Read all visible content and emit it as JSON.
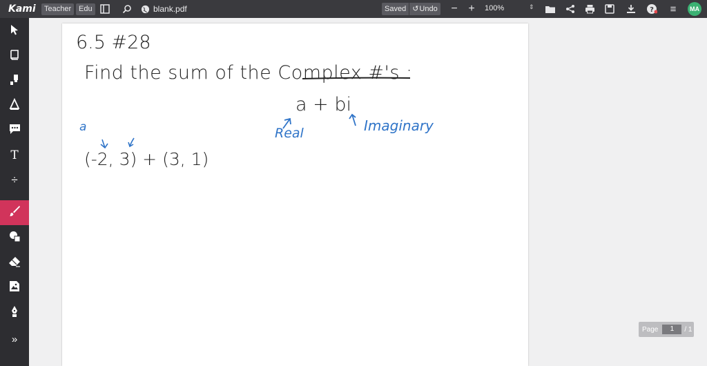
{
  "app": {
    "logo": "Kami",
    "badges": [
      "Teacher",
      "Edu"
    ],
    "filename": "blank.pdf",
    "saved_label": "Saved",
    "undo_label": "Undo",
    "zoom": "100%",
    "avatar_initials": "MA"
  },
  "colors": {
    "topbar": "#3a3a3e",
    "sidebar": "#2d2d31",
    "active_tool": "#d1345b",
    "ink_blue": "#2f74c8",
    "avatar": "#3bb273"
  },
  "sidebar": {
    "tools": [
      {
        "icon": "cursor-icon"
      },
      {
        "icon": "book-icon"
      },
      {
        "icon": "highlighter-icon"
      },
      {
        "icon": "markup-icon"
      },
      {
        "icon": "comment-icon"
      },
      {
        "icon": "text-icon",
        "glyph": "T"
      },
      {
        "icon": "equation-icon",
        "glyph": "÷"
      },
      {
        "icon": "brush-icon",
        "active": true
      },
      {
        "icon": "shapes-icon"
      },
      {
        "icon": "eraser-icon"
      },
      {
        "icon": "image-icon"
      },
      {
        "icon": "signature-icon"
      },
      {
        "icon": "expand-icon",
        "glyph": "»"
      }
    ]
  },
  "document": {
    "lines": {
      "problem": "6.5  #28",
      "instruction": "Find  the  sum  of  the  Complex #'s :",
      "form": "a  +  bi",
      "label_real": "Real",
      "label_imaginary": "Imaginary",
      "label_a": "a",
      "expression": "(-2,  3)  +  (3, 1)"
    }
  },
  "pager": {
    "label": "Page",
    "current": "1",
    "total": "/ 1"
  }
}
